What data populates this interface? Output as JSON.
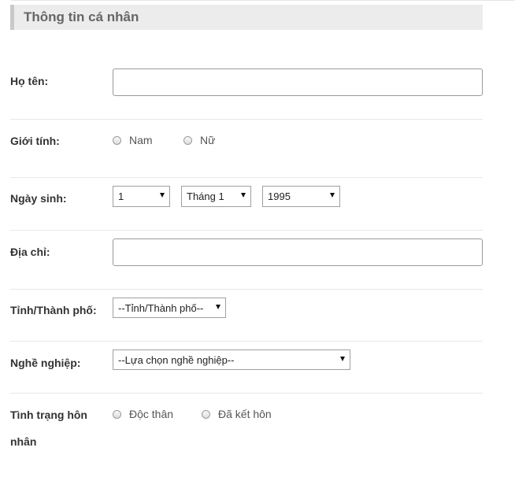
{
  "section": {
    "title": "Thông tin cá nhân"
  },
  "fields": {
    "fullname": {
      "label": "Họ tên:",
      "value": ""
    },
    "gender": {
      "label": "Giới tính:",
      "options": [
        "Nam",
        "Nữ"
      ]
    },
    "birthdate": {
      "label": "Ngày sinh:",
      "day": "1",
      "month": "Tháng 1",
      "year": "1995"
    },
    "address": {
      "label": "Địa chỉ:",
      "value": ""
    },
    "province": {
      "label": "Tỉnh/Thành phố:",
      "selected": "--Tỉnh/Thành phố--"
    },
    "occupation": {
      "label": "Nghề nghiệp:",
      "selected": "--Lựa chọn nghề nghiệp--"
    },
    "marital": {
      "label_line1": "Tình trạng hôn",
      "label_line2": "nhân",
      "options": [
        "Độc thân",
        "Đã kết hôn"
      ]
    }
  }
}
